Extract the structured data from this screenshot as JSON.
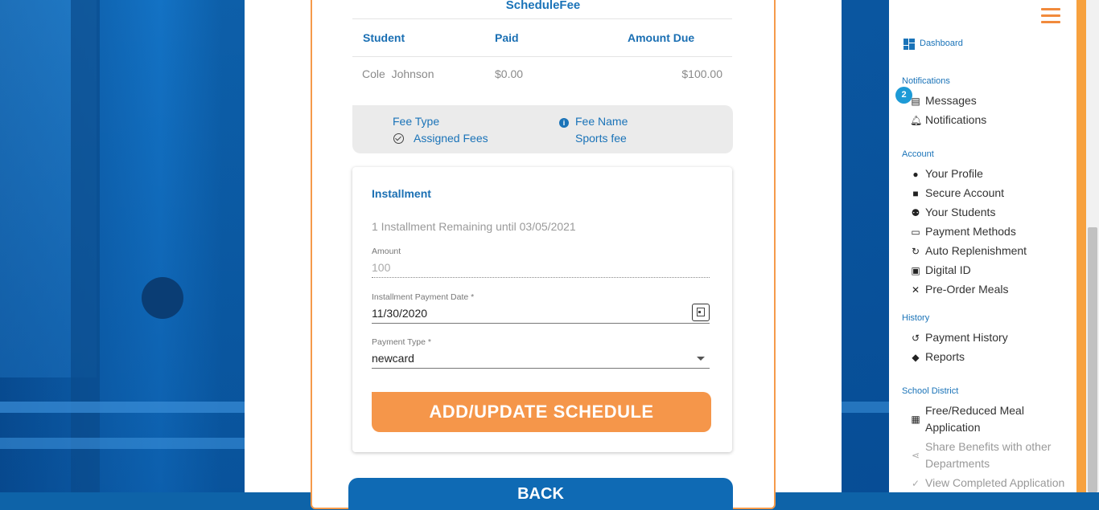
{
  "schedule": {
    "title": "ScheduleFee",
    "columns": [
      "Student",
      "Paid",
      "Amount Due"
    ],
    "rows": [
      {
        "student": "Cole  Johnson",
        "paid": "$0.00",
        "amount_due": "$100.00"
      }
    ]
  },
  "fee": {
    "type_label": "Fee Type",
    "type_value": "Assigned Fees",
    "name_label": "Fee Name",
    "name_value": "Sports fee"
  },
  "installment": {
    "title": "Installment",
    "remaining": "1 Installment Remaining until 03/05/2021",
    "amount_label": "Amount",
    "amount_value": "100",
    "date_label": "Installment Payment Date *",
    "date_value": "11/30/2020",
    "payment_type_label": "Payment Type *",
    "payment_type_value": "newcard",
    "add_button": "ADD/UPDATE SCHEDULE"
  },
  "back_button": "BACK",
  "sidebar": {
    "dashboard": "Dashboard",
    "sections": {
      "notifications": "Notifications",
      "account": "Account",
      "history": "History",
      "school_district": "School District"
    },
    "messages_badge": "2",
    "items": {
      "messages": "Messages",
      "notifications": "Notifications",
      "your_profile": "Your Profile",
      "secure_account": "Secure Account",
      "your_students": "Your Students",
      "payment_methods": "Payment Methods",
      "auto_replenishment": "Auto Replenishment",
      "digital_id": "Digital ID",
      "pre_order_meals": "Pre-Order Meals",
      "payment_history": "Payment History",
      "reports": "Reports",
      "free_reduced_1": "Free/Reduced Meal",
      "free_reduced_2": "Application",
      "share_benefits_1": "Share Benefits with other",
      "share_benefits_2": "Departments",
      "view_completed": "View Completed Application"
    }
  },
  "colors": {
    "brand_blue": "#1a73b8",
    "accent_orange": "#f5964a",
    "badge_blue": "#1d9ad6"
  }
}
